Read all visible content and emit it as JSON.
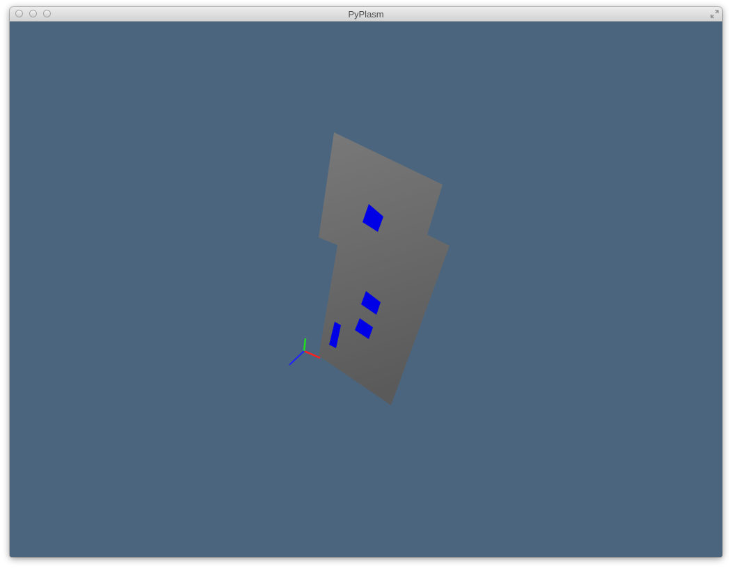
{
  "window": {
    "title": "PyPlasm",
    "background_color": "#4b657f"
  },
  "titlebar": {
    "buttons": [
      "close-button",
      "minimize-button",
      "zoom-button"
    ],
    "fullscreen_icon": "fullscreen-arrows-icon"
  },
  "scene": {
    "wall_color": "#6f6f6f",
    "window_color": "#0000e6",
    "axis_colors": {
      "x": "#ff2020",
      "y": "#22dd22",
      "z": "#2020ff"
    }
  }
}
